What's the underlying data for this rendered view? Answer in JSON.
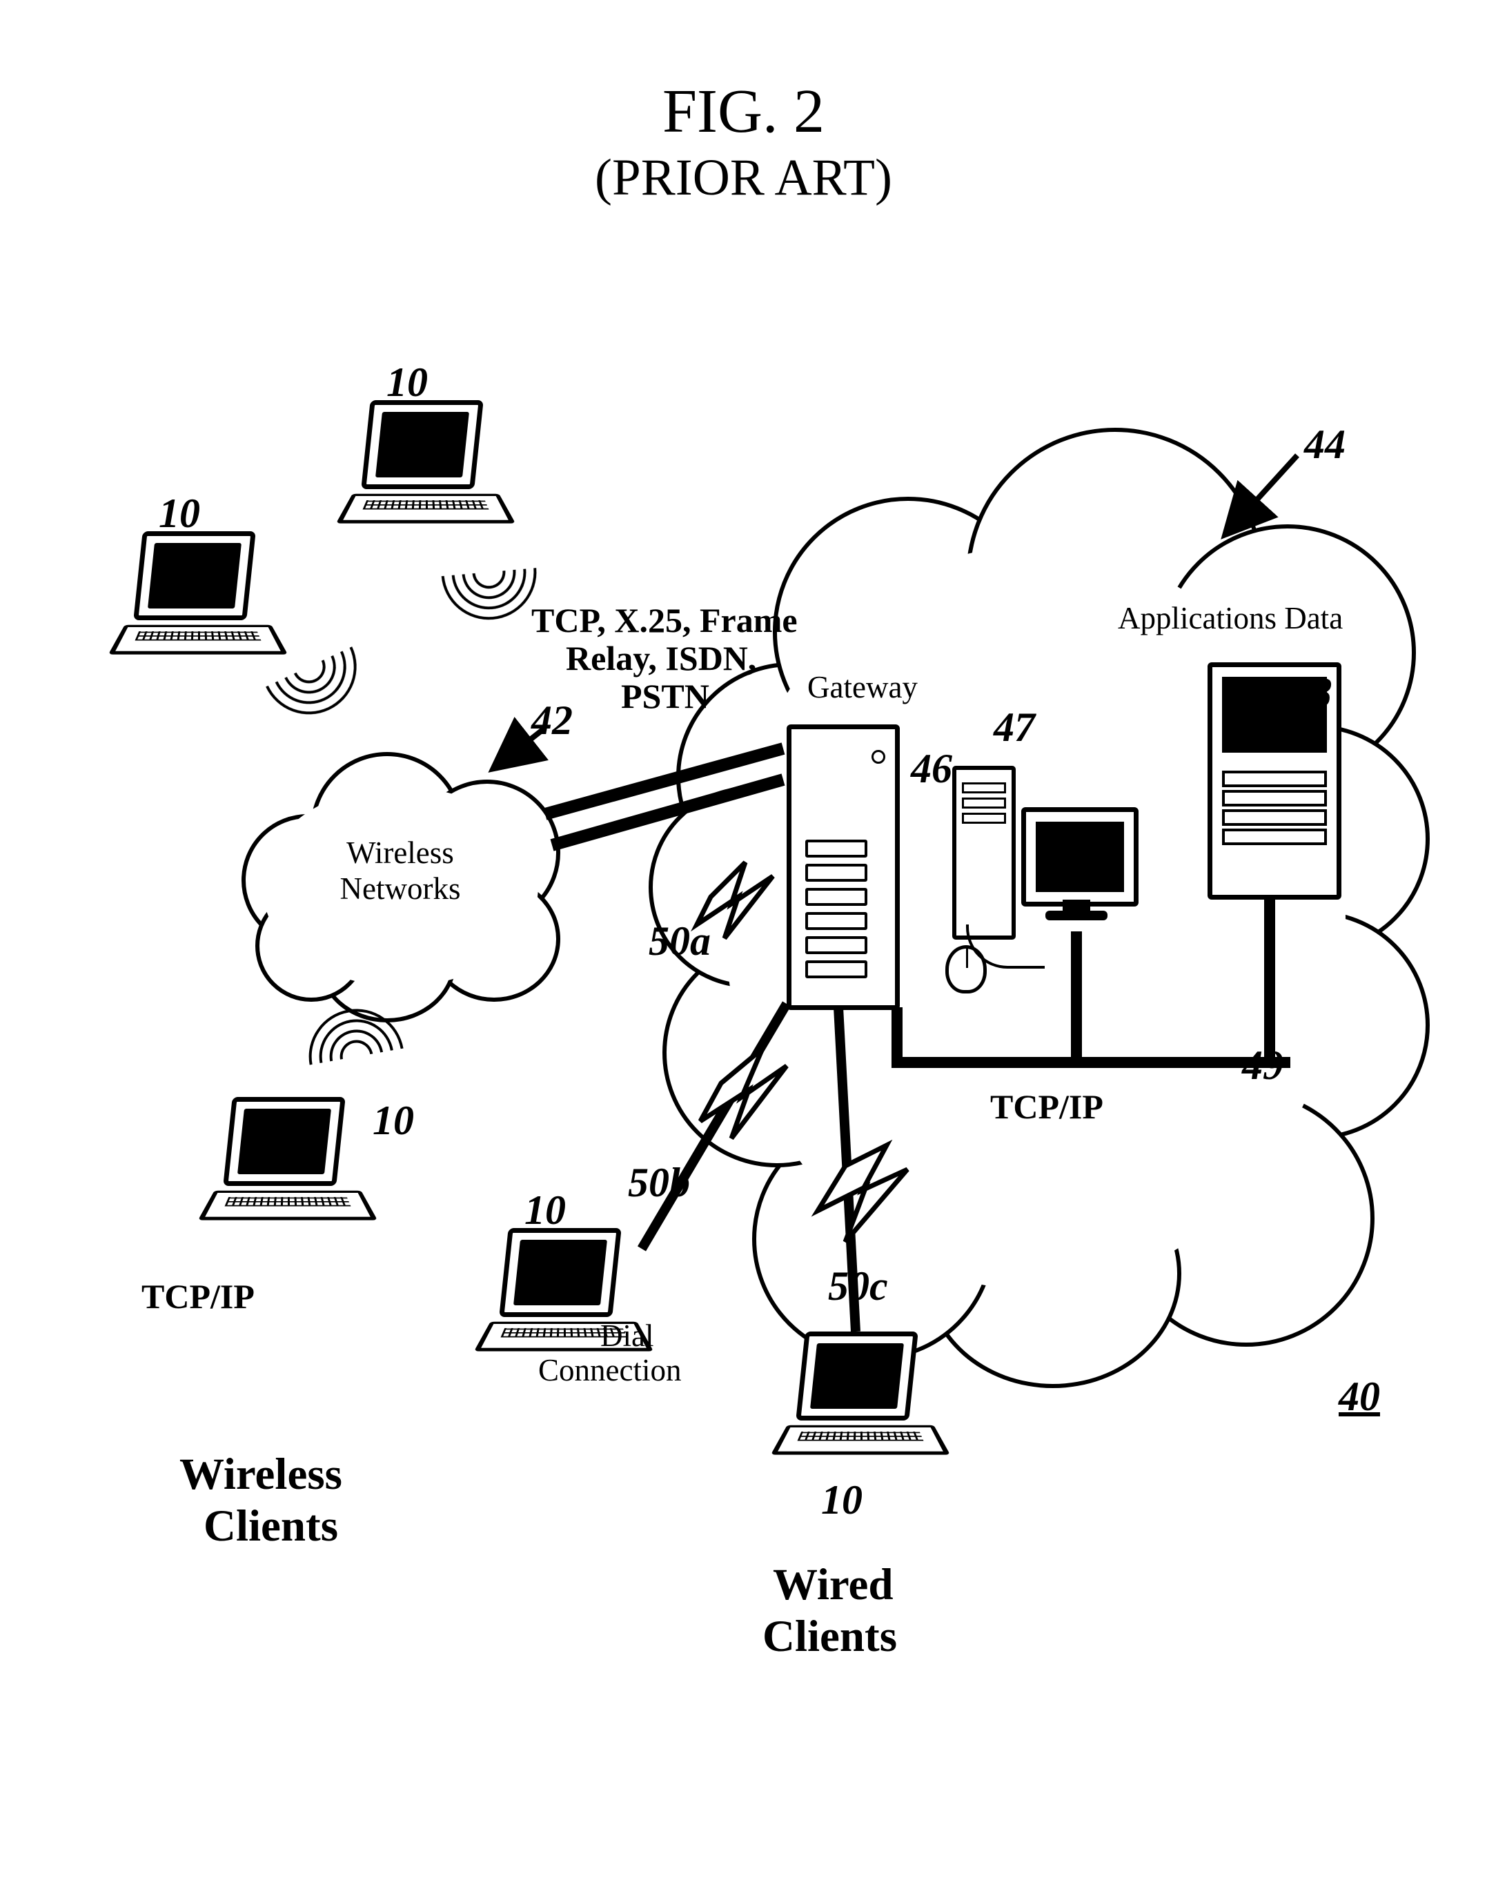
{
  "figure": {
    "number_label": "FIG. 2",
    "caption": "(PRIOR ART)"
  },
  "reference_numerals": {
    "laptop_tl": "10",
    "laptop_tl2": "10",
    "laptop_bl": "10",
    "laptop_mid": "10",
    "laptop_br": "10",
    "system": "40",
    "wireless_cloud": "42",
    "enterprise_cloud": "44",
    "gateway": "46",
    "workstation": "47",
    "server": "48",
    "lan_link": "49",
    "link_a": "50a",
    "link_b": "50b",
    "link_c": "50c"
  },
  "labels": {
    "wireless_networks": "Wireless\nNetworks",
    "wan_protocols_l1": "TCP, X.25, Frame",
    "wan_protocols_l2": "Relay, ISDN,",
    "wan_protocols_l3": "PSTN",
    "gateway": "Gateway",
    "applications_data": "Applications Data",
    "tcpip_left": "TCP/IP",
    "tcpip_right": "TCP/IP",
    "dial_connection_l1": "Dial",
    "dial_connection_l2": "Connection",
    "wireless_clients_l1": "Wireless",
    "wireless_clients_l2": "Clients",
    "wired_clients_l1": "Wired",
    "wired_clients_l2": "Clients"
  },
  "icons": {
    "laptop": "laptop-icon",
    "cloud_small": "cloud-icon",
    "cloud_large": "cloud-icon",
    "radio_waves": "radio-waves-icon",
    "gateway_tower": "tower-computer-icon",
    "workstation_pc": "desktop-pc-icon",
    "workstation_monitor": "monitor-icon",
    "mouse": "mouse-icon",
    "server": "server-icon",
    "lightning": "lightning-connector-icon"
  }
}
